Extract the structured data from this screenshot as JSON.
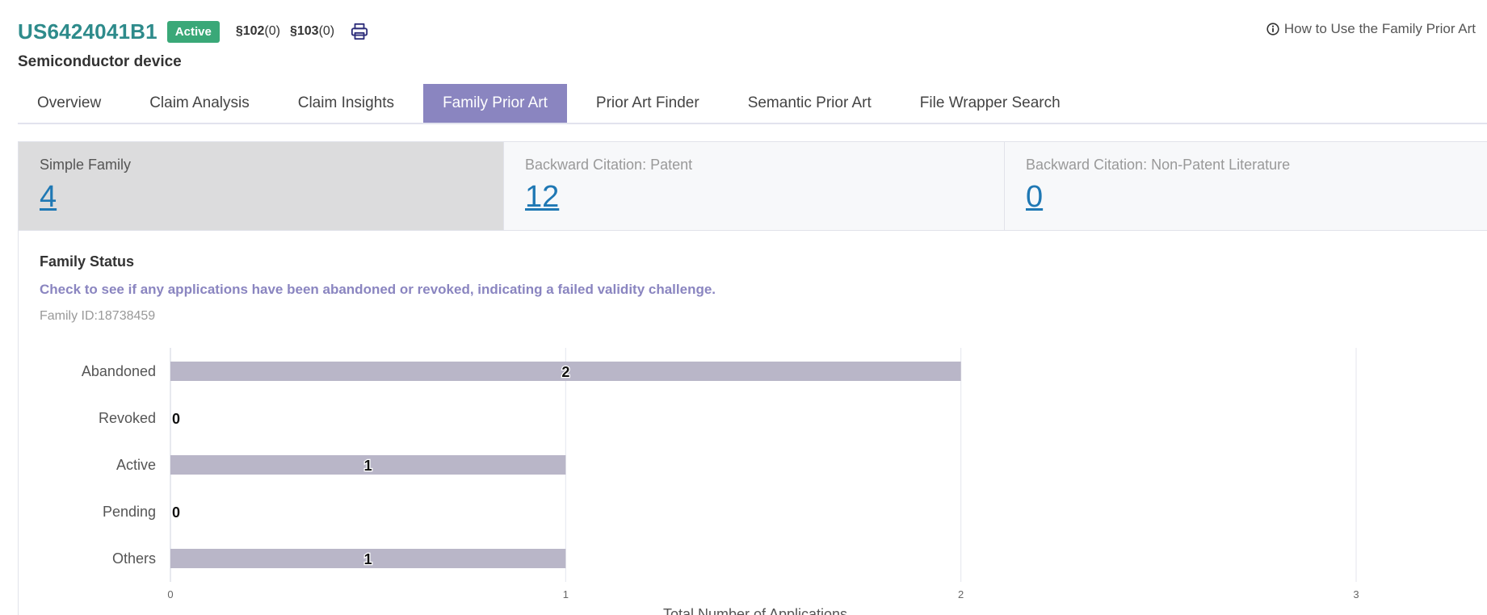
{
  "header": {
    "patent_id": "US6424041B1",
    "status": "Active",
    "sec102_label": "§102",
    "sec102_count": "(0)",
    "sec103_label": "§103",
    "sec103_count": "(0)",
    "title": "Semiconductor device",
    "print_icon": "printer-icon"
  },
  "help": {
    "icon": "info-circle-icon",
    "label": "How to Use the Family Prior Art"
  },
  "tabs": [
    {
      "label": "Overview"
    },
    {
      "label": "Claim Analysis"
    },
    {
      "label": "Claim Insights"
    },
    {
      "label": "Family Prior Art",
      "active": true
    },
    {
      "label": "Prior Art Finder"
    },
    {
      "label": "Semantic Prior Art"
    },
    {
      "label": "File Wrapper Search"
    }
  ],
  "stats": [
    {
      "label": "Simple Family",
      "value": "4"
    },
    {
      "label": "Backward Citation: Patent",
      "value": "12"
    },
    {
      "label": "Backward Citation: Non-Patent Literature",
      "value": "0"
    }
  ],
  "family_status": {
    "title": "Family Status",
    "description": "Check to see if any applications have been abandoned or revoked, indicating a failed validity challenge.",
    "family_id": "Family ID:18738459"
  },
  "colors": {
    "accent": "#8a85c0",
    "bar": "#b9b6c8",
    "link": "#1f78b4",
    "badge": "#3aa878",
    "patent_id": "#2e8b8b"
  },
  "chart_data": {
    "type": "bar",
    "orientation": "horizontal",
    "categories": [
      "Abandoned",
      "Revoked",
      "Active",
      "Pending",
      "Others"
    ],
    "values": [
      2,
      0,
      1,
      0,
      1
    ],
    "xlabel": "Total Number of Applications",
    "ylabel": "",
    "xlim": [
      0,
      3
    ],
    "xticks": [
      0,
      1,
      2,
      3
    ],
    "grid": true,
    "legend": "none",
    "data_labels": true
  }
}
